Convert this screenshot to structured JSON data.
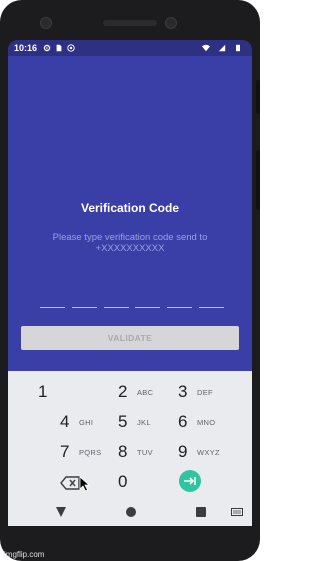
{
  "status_bar": {
    "time": "10:16",
    "icons_left": [
      "gear-icon",
      "sim-card-icon",
      "at-sign-icon"
    ],
    "icons_right": [
      "wifi-icon",
      "signal-icon",
      "battery-icon"
    ]
  },
  "screen": {
    "title": "Verification Code",
    "subtitle": "Please type verification code send to +XXXXXXXXXX",
    "code_slots": 6,
    "validate_label": "VALIDATE",
    "colors": {
      "primary": "#3a3fa8",
      "status_bar": "#2e3183",
      "button_disabled": "#d6d6d8",
      "keyboard_accent": "#2fc5a0"
    }
  },
  "keyboard": {
    "keys": [
      {
        "num": "1",
        "letters": ""
      },
      {
        "num": "2",
        "letters": "ABC"
      },
      {
        "num": "3",
        "letters": "DEF"
      },
      {
        "num": "4",
        "letters": "GHI"
      },
      {
        "num": "5",
        "letters": "JKL"
      },
      {
        "num": "6",
        "letters": "MNO"
      },
      {
        "num": "7",
        "letters": "PQRS"
      },
      {
        "num": "8",
        "letters": "TUV"
      },
      {
        "num": "9",
        "letters": "WXYZ"
      },
      {
        "num": "0",
        "letters": ""
      }
    ],
    "delete_icon": "backspace-icon",
    "go_icon": "tab-forward-icon"
  },
  "nav_bar": {
    "icons": [
      "back-triangle-icon",
      "home-circle-icon",
      "recents-square-icon",
      "keyboard-icon"
    ]
  },
  "watermark": "imgflip.com"
}
